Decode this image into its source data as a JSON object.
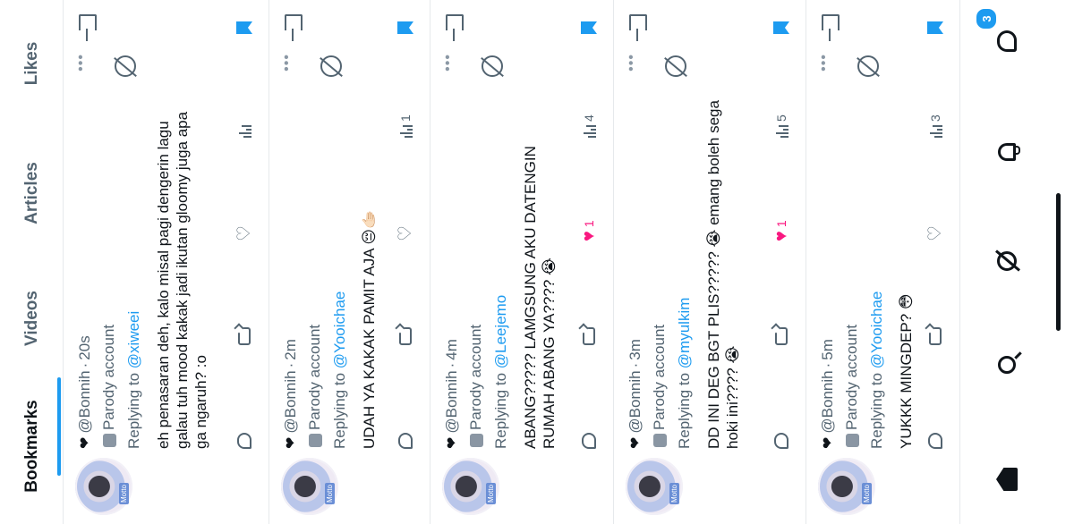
{
  "tabs": [
    "Bookmarks",
    "Videos",
    "Articles",
    "Likes"
  ],
  "active_tab": "Bookmarks",
  "tweets": [
    {
      "handle": "@Bonnih",
      "time": "20s",
      "parody": "Parody account",
      "replying_prefix": "Replying to",
      "replying_to": "@xiweei",
      "text": "eh penasaran deh, kalo misal pagi dengerin lagu galau tuh mood kakak jadi ikutan gloomy juga apa ga ngaruh? :o",
      "likes": "",
      "liked": false,
      "views": ""
    },
    {
      "handle": "@Bonnih",
      "time": "2m",
      "parody": "Parody account",
      "replying_prefix": "Replying to",
      "replying_to": "@Yooichae",
      "text": "UDAH YA KAKAK PAMIT AJA 😔🫱🏻",
      "likes": "",
      "liked": false,
      "views": "1"
    },
    {
      "handle": "@Bonnih",
      "time": "4m",
      "parody": "Parody account",
      "replying_prefix": "Replying to",
      "replying_to": "@Leejemo",
      "text": "ABANG????? LAMGSUNG AKU DATENGIN RUMAH ABANG YA???? 😭",
      "likes": "1",
      "liked": true,
      "views": "4"
    },
    {
      "handle": "@Bonnih",
      "time": "3m",
      "parody": "Parody account",
      "replying_prefix": "Replying to",
      "replying_to": "@myulkim",
      "text": "DD INI DEG BGT PLIS????? 😭 emang boleh sega hoki ini???? 😭",
      "likes": "1",
      "liked": true,
      "views": "5"
    },
    {
      "handle": "@Bonnih",
      "time": "5m",
      "parody": "Parody account",
      "replying_prefix": "Replying to",
      "replying_to": "@Yooichae",
      "text": "YUKKK MINGDEP? 😳",
      "likes": "",
      "liked": false,
      "views": "3"
    }
  ],
  "avatar_caption": "Motto",
  "bottom_nav": {
    "items": [
      "home-icon",
      "search-icon",
      "grok-icon",
      "bell-icon",
      "messages-icon"
    ],
    "messages_badge": "3"
  },
  "colors": {
    "accent": "#1d9bf0",
    "like": "#f91880",
    "text": "#0f1419",
    "muted": "#536471"
  }
}
